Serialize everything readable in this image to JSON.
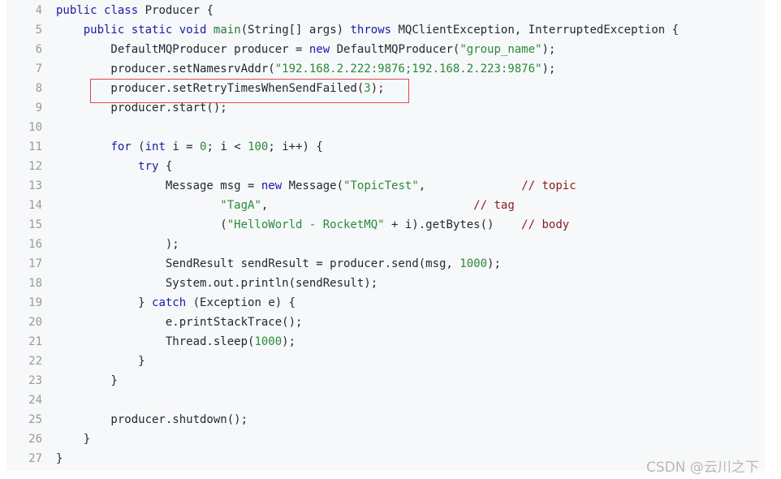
{
  "colors": {
    "background": "#f6f8fa",
    "keyword": "#1a1aa6",
    "string": "#2a8a3a",
    "comment": "#8b1a1a",
    "highlight_box": "#e0474c"
  },
  "lines": [
    {
      "n": "4",
      "t": [
        [
          "k",
          "public"
        ],
        [
          "p",
          " "
        ],
        [
          "k",
          "class"
        ],
        [
          "p",
          " Producer {"
        ]
      ]
    },
    {
      "n": "5",
      "t": [
        [
          "p",
          "    "
        ],
        [
          "k",
          "public"
        ],
        [
          "p",
          " "
        ],
        [
          "k",
          "static"
        ],
        [
          "p",
          " "
        ],
        [
          "k",
          "void"
        ],
        [
          "p",
          " "
        ],
        [
          "f",
          "main"
        ],
        [
          "p",
          "(String[] args) "
        ],
        [
          "k",
          "throws"
        ],
        [
          "p",
          " MQClientException, InterruptedException {"
        ]
      ]
    },
    {
      "n": "6",
      "t": [
        [
          "p",
          "        DefaultMQProducer producer = "
        ],
        [
          "k",
          "new"
        ],
        [
          "p",
          " DefaultMQProducer("
        ],
        [
          "s",
          "\"group_name\""
        ],
        [
          "p",
          ");"
        ]
      ]
    },
    {
      "n": "7",
      "t": [
        [
          "p",
          "        producer.setNamesrvAddr("
        ],
        [
          "s",
          "\"192.168.2.222:9876;192.168.2.223:9876\""
        ],
        [
          "p",
          ");"
        ]
      ]
    },
    {
      "n": "8",
      "t": [
        [
          "p",
          "        producer.setRetryTimesWhenSendFailed("
        ],
        [
          "n",
          "3"
        ],
        [
          "p",
          ");"
        ]
      ]
    },
    {
      "n": "9",
      "t": [
        [
          "p",
          "        producer.start();"
        ]
      ]
    },
    {
      "n": "10",
      "t": []
    },
    {
      "n": "11",
      "t": [
        [
          "p",
          "        "
        ],
        [
          "k",
          "for"
        ],
        [
          "p",
          " ("
        ],
        [
          "k",
          "int"
        ],
        [
          "p",
          " i = "
        ],
        [
          "n",
          "0"
        ],
        [
          "p",
          "; i < "
        ],
        [
          "n",
          "100"
        ],
        [
          "p",
          "; i++) {"
        ]
      ]
    },
    {
      "n": "12",
      "t": [
        [
          "p",
          "            "
        ],
        [
          "k",
          "try"
        ],
        [
          "p",
          " {"
        ]
      ]
    },
    {
      "n": "13",
      "t": [
        [
          "p",
          "                Message msg = "
        ],
        [
          "k",
          "new"
        ],
        [
          "p",
          " Message("
        ],
        [
          "s",
          "\"TopicTest\""
        ],
        [
          "p",
          ",              "
        ],
        [
          "c",
          "// topic"
        ]
      ]
    },
    {
      "n": "14",
      "t": [
        [
          "p",
          "                        "
        ],
        [
          "s",
          "\"TagA\""
        ],
        [
          "p",
          ",                              "
        ],
        [
          "c",
          "// tag"
        ]
      ]
    },
    {
      "n": "15",
      "t": [
        [
          "p",
          "                        ("
        ],
        [
          "s",
          "\"HelloWorld - RocketMQ\""
        ],
        [
          "p",
          " + i).getBytes()    "
        ],
        [
          "c",
          "// body"
        ]
      ]
    },
    {
      "n": "16",
      "t": [
        [
          "p",
          "                );"
        ]
      ]
    },
    {
      "n": "17",
      "t": [
        [
          "p",
          "                SendResult sendResult = producer.send(msg, "
        ],
        [
          "n",
          "1000"
        ],
        [
          "p",
          ");"
        ]
      ]
    },
    {
      "n": "18",
      "t": [
        [
          "p",
          "                System.out.println(sendResult);"
        ]
      ]
    },
    {
      "n": "19",
      "t": [
        [
          "p",
          "            } "
        ],
        [
          "k",
          "catch"
        ],
        [
          "p",
          " (Exception e) {"
        ]
      ]
    },
    {
      "n": "20",
      "t": [
        [
          "p",
          "                e.printStackTrace();"
        ]
      ]
    },
    {
      "n": "21",
      "t": [
        [
          "p",
          "                Thread.sleep("
        ],
        [
          "n",
          "1000"
        ],
        [
          "p",
          ");"
        ]
      ]
    },
    {
      "n": "22",
      "t": [
        [
          "p",
          "            }"
        ]
      ]
    },
    {
      "n": "23",
      "t": [
        [
          "p",
          "        }"
        ]
      ]
    },
    {
      "n": "24",
      "t": []
    },
    {
      "n": "25",
      "t": [
        [
          "p",
          "        producer.shutdown();"
        ]
      ]
    },
    {
      "n": "26",
      "t": [
        [
          "p",
          "    }"
        ]
      ]
    },
    {
      "n": "27",
      "t": [
        [
          "p",
          "}"
        ]
      ]
    }
  ],
  "watermark": "CSDN @云川之下"
}
